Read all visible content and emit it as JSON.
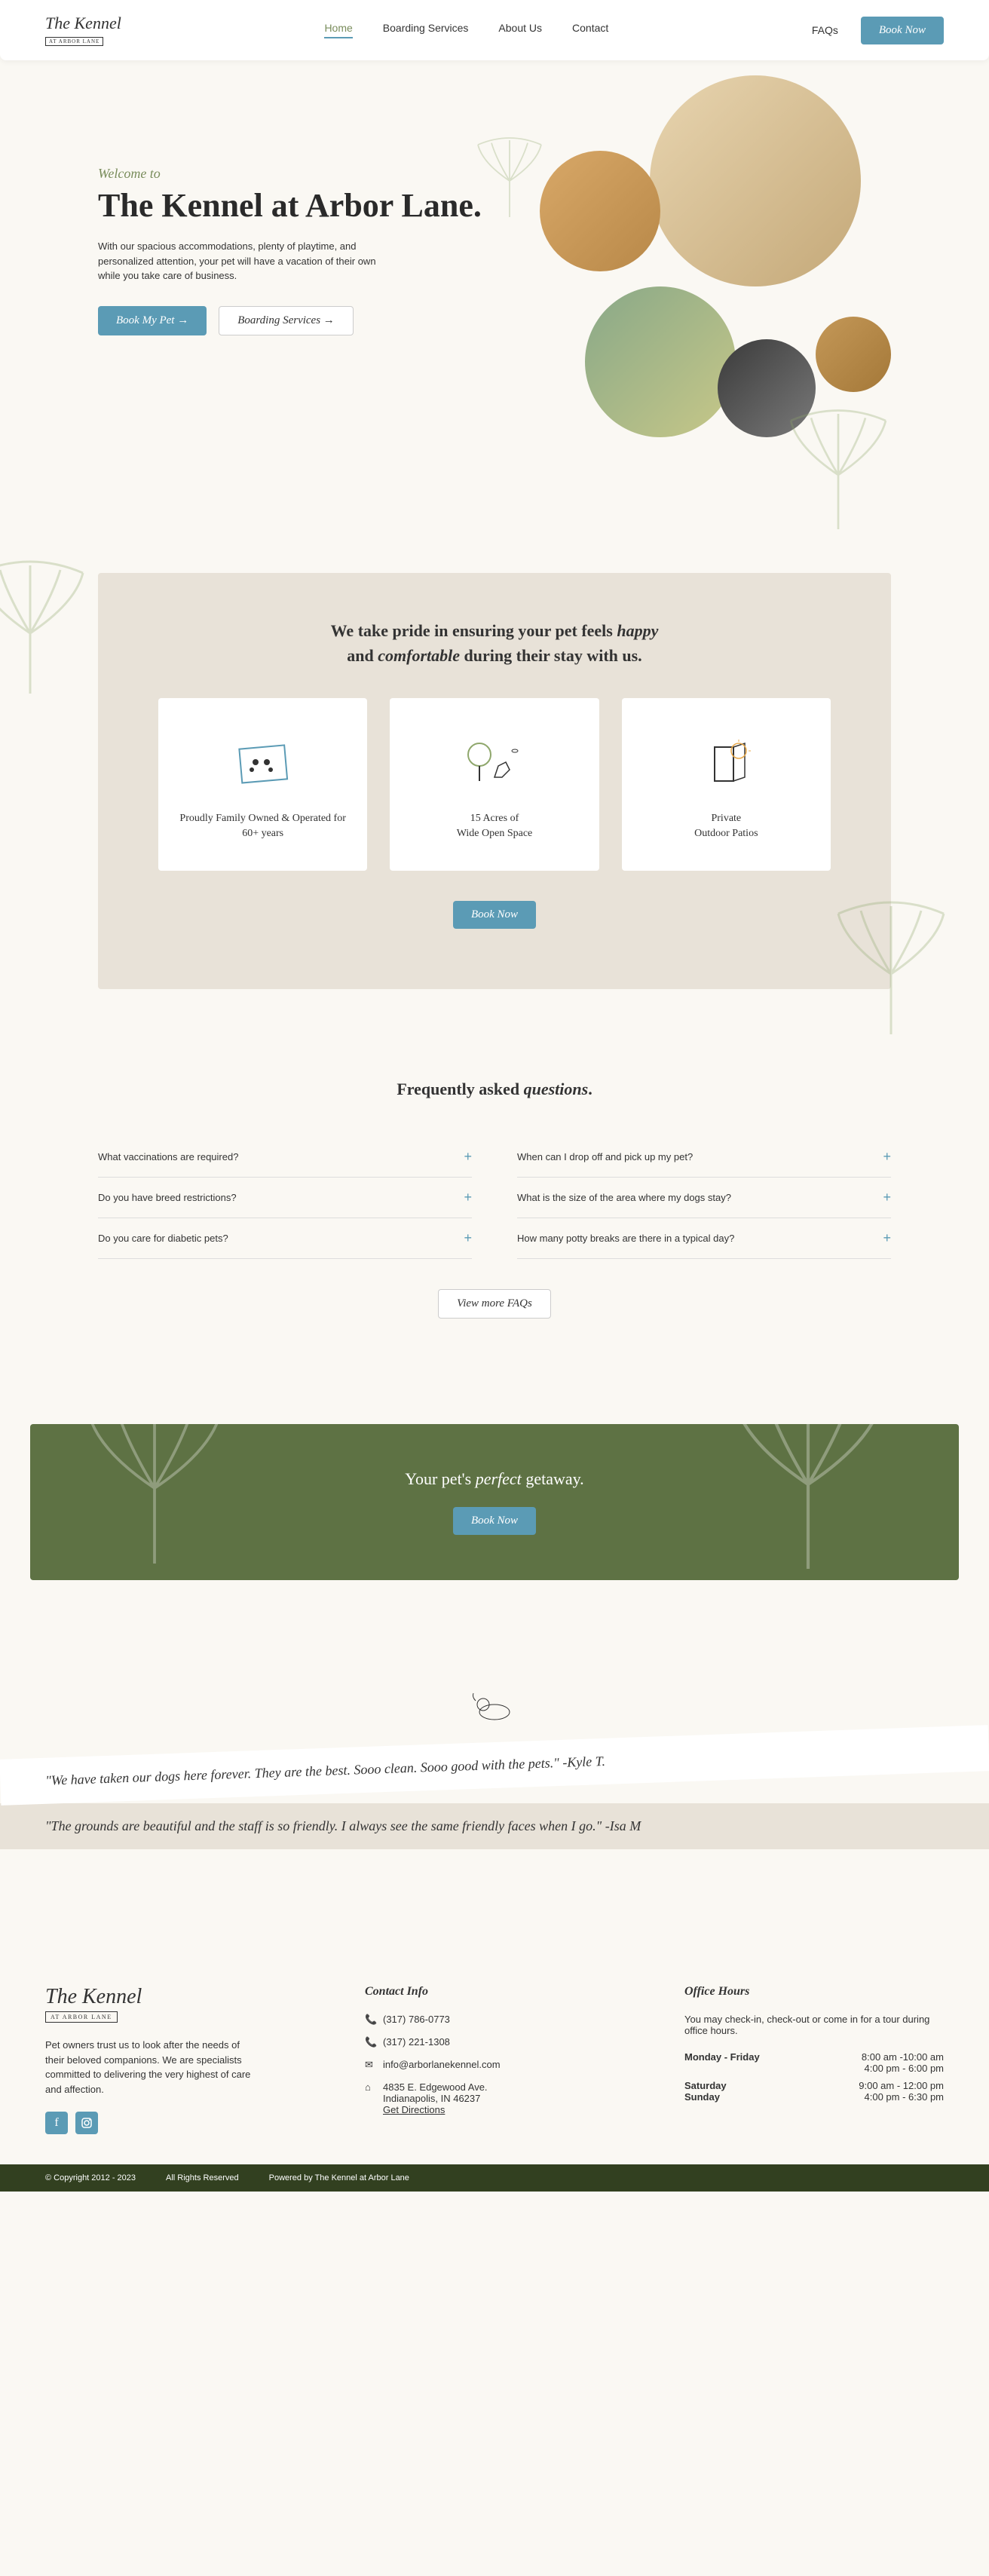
{
  "header": {
    "logo_main": "The Kennel",
    "logo_sub": "AT ARBOR LANE",
    "nav": {
      "home": "Home",
      "boarding": "Boarding Services",
      "about": "About Us",
      "contact": "Contact"
    },
    "faqs": "FAQs",
    "book": "Book Now"
  },
  "hero": {
    "welcome": "Welcome to",
    "title": "The Kennel at Arbor Lane.",
    "desc": "With our spacious accommodations, plenty of playtime, and personalized attention, your pet will have a vacation of their own while you take care of business.",
    "btn1": "Book My Pet  →",
    "btn2": "Boarding Services   →"
  },
  "features": {
    "title_1": "We take pride in ensuring your pet feels ",
    "title_happy": "happy",
    "title_2": " and ",
    "title_comfortable": "comfortable",
    "title_3": " during their stay with us.",
    "cards": [
      "Proudly Family Owned & Operated for 60+ years",
      "15 Acres of\nWide Open Space",
      "Private\nOutdoor Patios"
    ],
    "btn": "Book Now"
  },
  "faq": {
    "title_1": "Frequently asked ",
    "title_2": "questions",
    "title_3": ".",
    "left": [
      "What vaccinations are required?",
      "Do you have breed restrictions?",
      "Do you care for diabetic pets?"
    ],
    "right": [
      "When can I drop off and pick up my pet?",
      "What is the size of the area where my dogs stay?",
      "How many potty breaks are there in a typical day?"
    ],
    "btn": "View more FAQs"
  },
  "cta": {
    "text_1": "Your pet's ",
    "text_2": "perfect",
    "text_3": " getaway.",
    "btn": "Book Now"
  },
  "testimonials": {
    "t1": "\"We have taken our dogs here forever. They are the best. Sooo clean. Sooo good with the pets.\" -Kyle T.",
    "t2": "\"The grounds are beautiful and the staff is so friendly. I always see the same friendly faces when I go.\" -Isa M"
  },
  "footer": {
    "logo_main": "The Kennel",
    "logo_sub": "AT ARBOR LANE",
    "desc": "Pet owners trust us to look after the needs of their beloved companions. We are specialists committed to delivering the very highest of care and affection.",
    "contact_heading": "Contact Info",
    "phone1": "(317) 786-0773",
    "phone2": "(317) 221-1308",
    "email": "info@arborlanekennel.com",
    "address1": "4835 E. Edgewood Ave.",
    "address2": "Indianapolis, IN 46237",
    "directions": "Get Directions",
    "hours_heading": "Office Hours",
    "hours_desc": "You may check-in, check-out or come in for a tour during office hours.",
    "hours": [
      {
        "day": "Monday - Friday",
        "time": "8:00 am -10:00 am\n4:00 pm - 6:00 pm"
      },
      {
        "day": "Saturday\nSunday",
        "time": "9:00 am - 12:00 pm\n4:00 pm - 6:30 pm"
      }
    ]
  },
  "copyright": {
    "c1": "© Copyright 2012 - 2023",
    "c2": "All Rights Reserved",
    "c3": "Powered by The Kennel at Arbor Lane"
  }
}
